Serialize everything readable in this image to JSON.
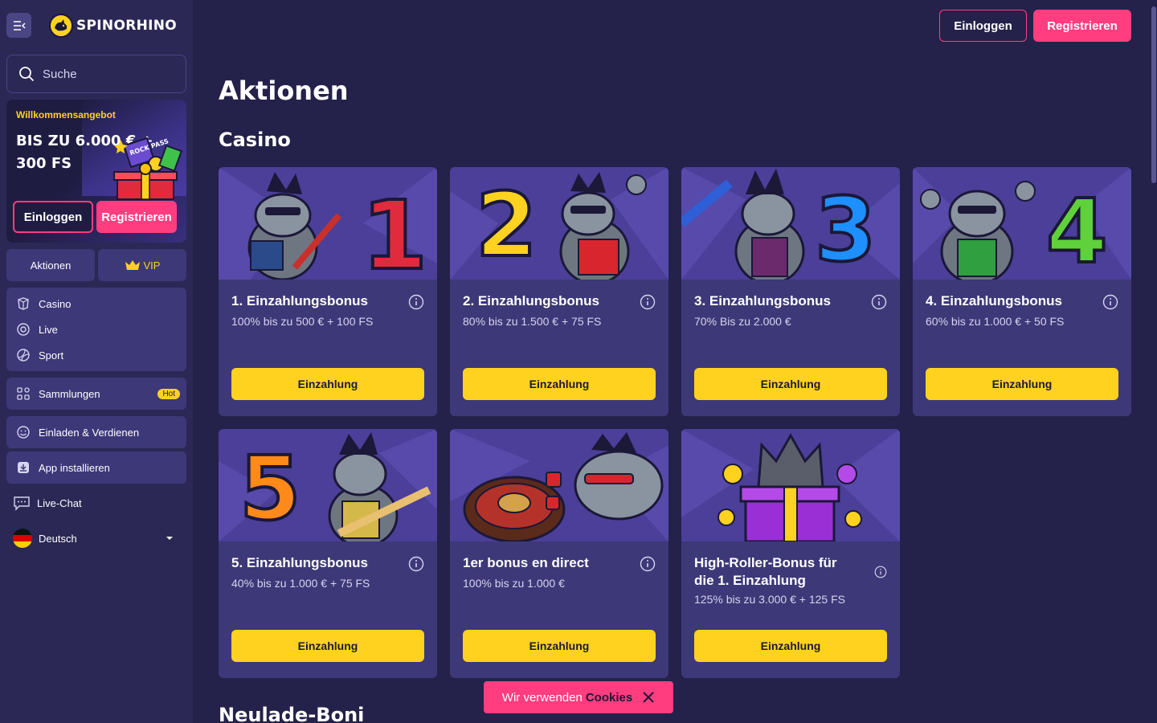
{
  "brand": {
    "name": "SPINORHINO"
  },
  "sidebar": {
    "search_placeholder": "Suche",
    "welcome": {
      "subtitle": "Willkommensangebot",
      "title": "BIS ZU 6.000 € + 300 FS",
      "art_text": "ROCK PASS",
      "login_label": "Einloggen",
      "register_label": "Registrieren"
    },
    "pills": {
      "promotions": "Aktionen",
      "vip": "VIP"
    },
    "games": [
      {
        "label": "Casino",
        "icon": "casino-chip-icon"
      },
      {
        "label": "Live",
        "icon": "live-icon"
      },
      {
        "label": "Sport",
        "icon": "sport-ball-icon"
      }
    ],
    "collections": {
      "label": "Sammlungen",
      "badge": "Hot"
    },
    "invite": {
      "label": "Einladen & Verdienen"
    },
    "install": {
      "label": "App installieren"
    },
    "chat": {
      "label": "Live-Chat"
    },
    "language": {
      "label": "Deutsch"
    }
  },
  "header": {
    "login_label": "Einloggen",
    "register_label": "Registrieren"
  },
  "main": {
    "title": "Aktionen",
    "section_casino": "Casino",
    "section_reload": "Neulade-Boni",
    "cards": [
      {
        "title": "1. Einzahlungsbonus",
        "subtitle": "100% bis zu 500 € + 100 FS",
        "button": "Einzahlung",
        "number": "1",
        "color": "#e02b3c"
      },
      {
        "title": "2. Einzahlungsbonus",
        "subtitle": "80% bis zu 1.500 € + 75 FS",
        "button": "Einzahlung",
        "number": "2",
        "color": "#ffd21f"
      },
      {
        "title": "3. Einzahlungsbonus",
        "subtitle": "70% Bis zu 2.000 €",
        "button": "Einzahlung",
        "number": "3",
        "color": "#1e8fff"
      },
      {
        "title": "4. Einzahlungsbonus",
        "subtitle": "60% bis zu 1.000 € + 50 FS",
        "button": "Einzahlung",
        "number": "4",
        "color": "#5fd13a"
      },
      {
        "title": "5. Einzahlungsbonus",
        "subtitle": "40% bis zu 1.000 € + 75 FS",
        "button": "Einzahlung",
        "number": "5",
        "color": "#ff8a1a"
      },
      {
        "title": "1er bonus en direct",
        "subtitle": "100% bis zu 1.000 €",
        "button": "Einzahlung"
      },
      {
        "title": "High-Roller-Bonus für die 1. Einzahlung",
        "subtitle": "125% bis zu 3.000 € + 125 FS",
        "button": "Einzahlung"
      }
    ]
  },
  "cookie_bar": {
    "text": "Wir verwenden",
    "highlight": "Cookies"
  },
  "colors": {
    "accent_pink": "#ff3d7f",
    "accent_yellow": "#ffd21f",
    "bg": "#24214a",
    "card": "#3d3878"
  }
}
